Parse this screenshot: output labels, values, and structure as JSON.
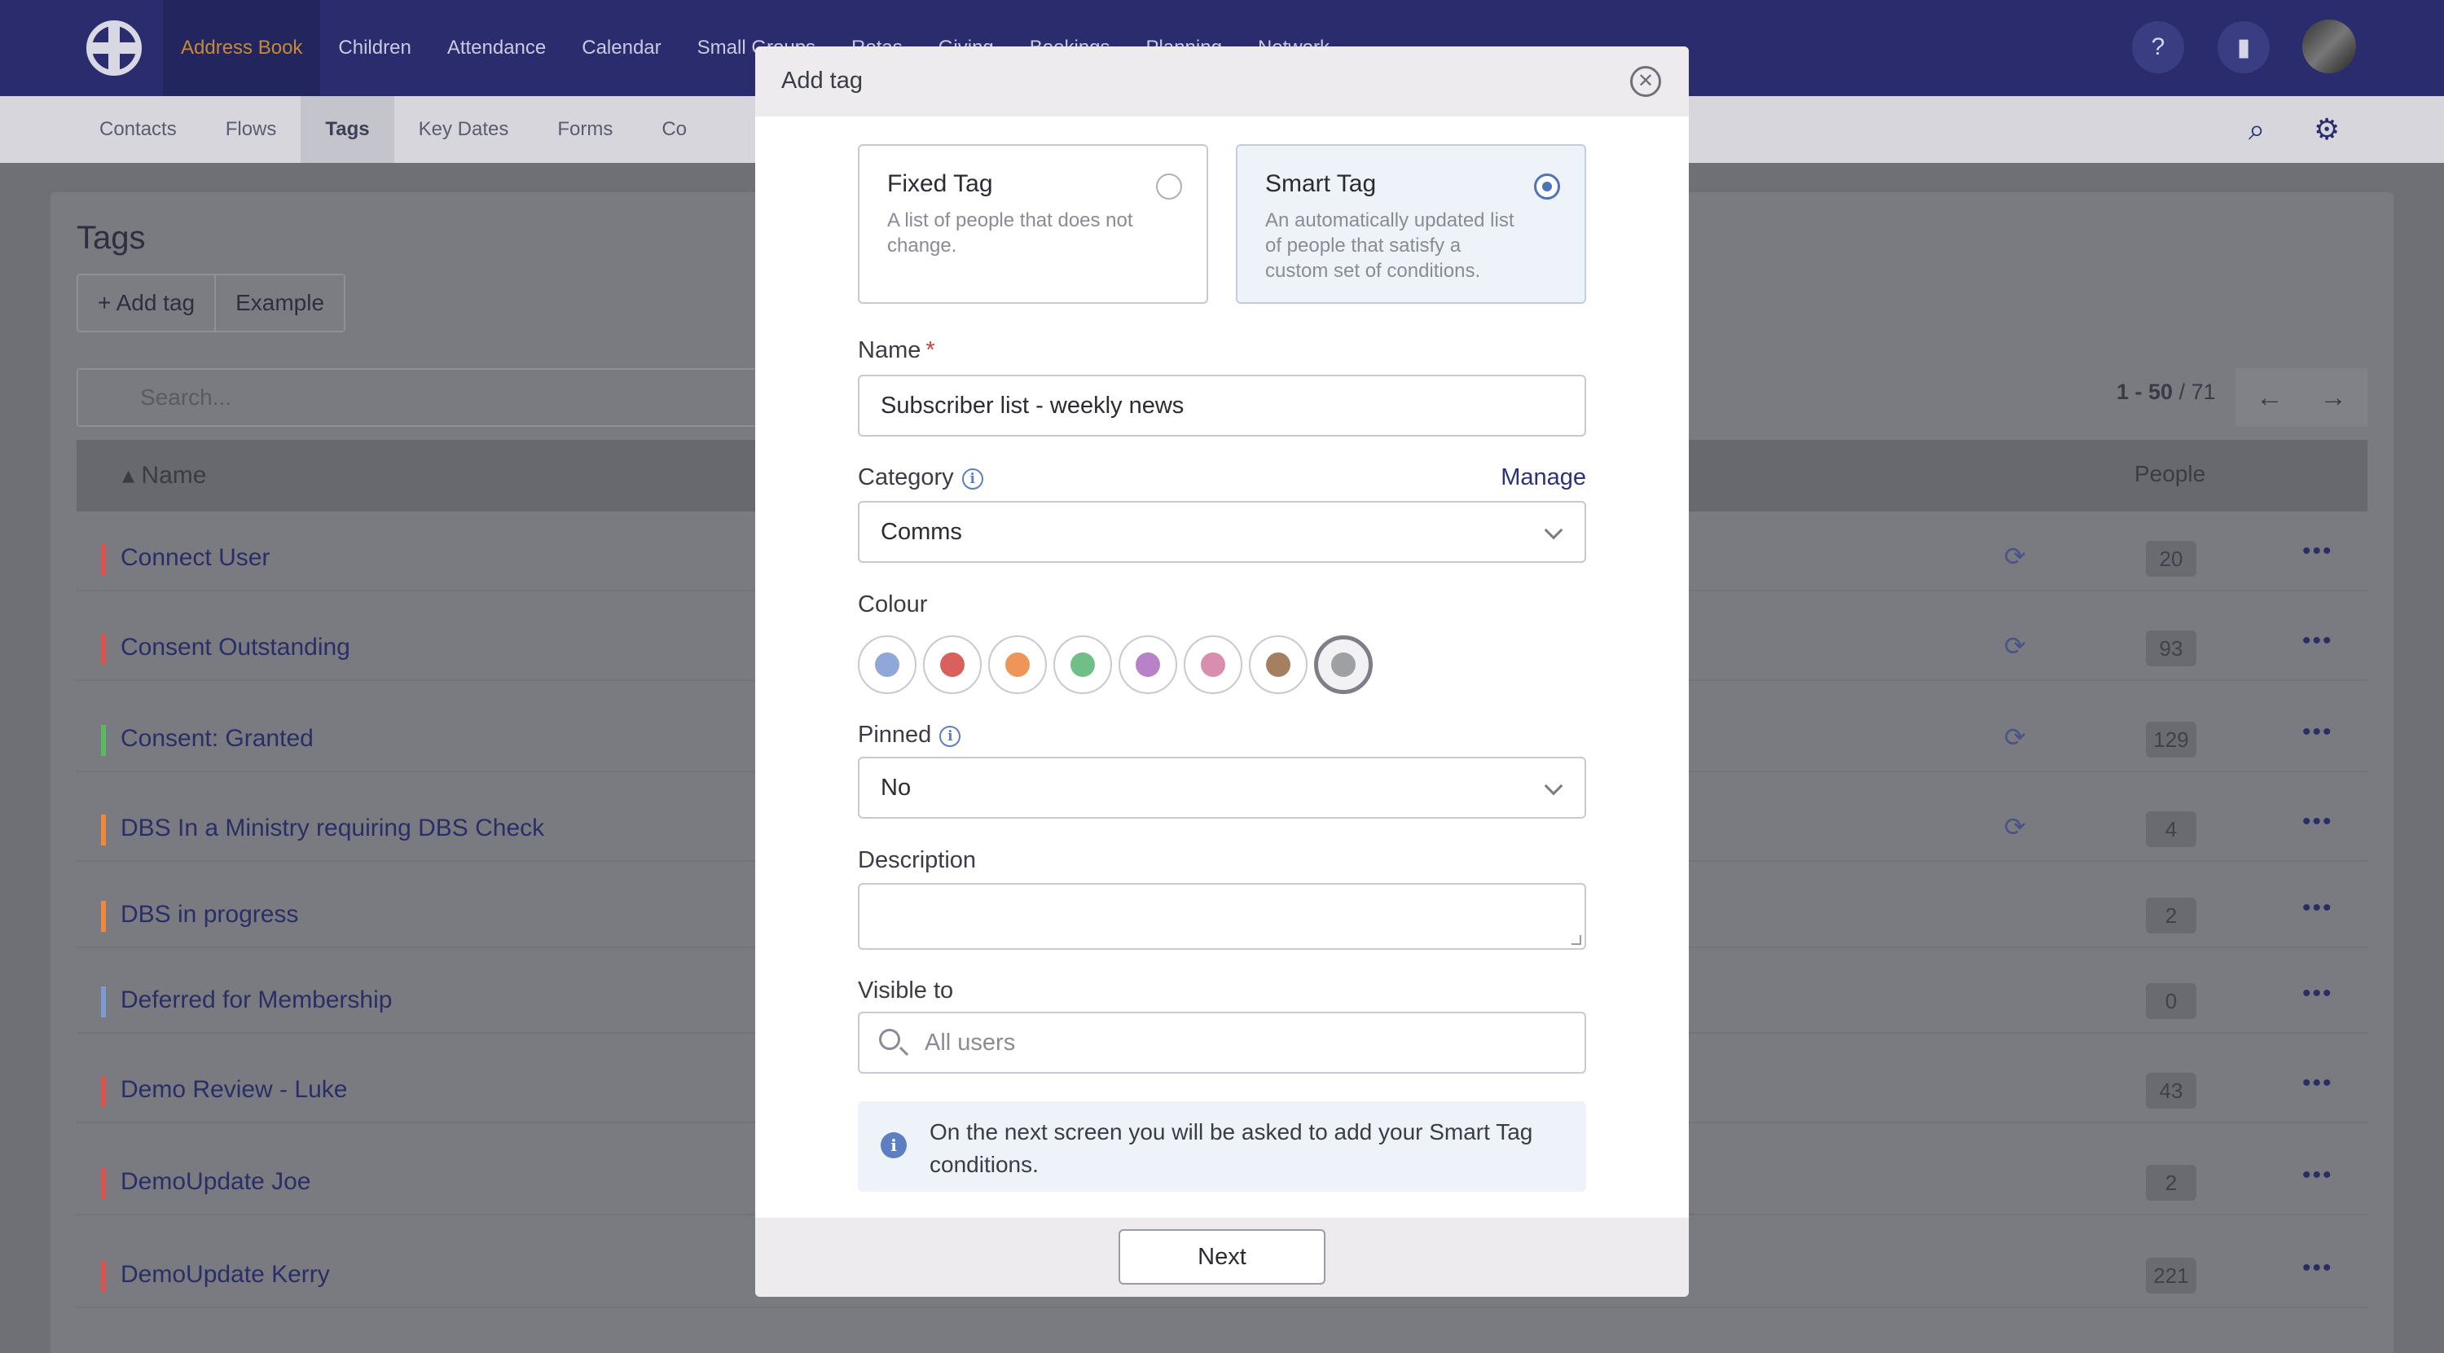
{
  "topnav": {
    "items": [
      "Address Book",
      "Children",
      "Attendance",
      "Calendar",
      "Small Groups",
      "Rotas",
      "Giving",
      "Bookings",
      "Planning",
      "Network"
    ],
    "help_icon": "help-circle-icon",
    "org_icon": "building-icon"
  },
  "subnav": {
    "items": [
      "Contacts",
      "Flows",
      "Tags",
      "Key Dates",
      "Forms",
      "Co"
    ],
    "search_icon": "search-icon",
    "settings_icon": "gear-icon"
  },
  "page": {
    "title": "Tags",
    "add_tag_label": "+ Add tag",
    "example_label": "Example",
    "search_placeholder": "Search...",
    "pager_range": "1 - 50",
    "pager_total": "/ 71",
    "col_name": "Name",
    "col_people": "People",
    "rows": [
      {
        "name": "Connect User",
        "count": "20",
        "color": "#d9534f"
      },
      {
        "name": "Consent Outstanding",
        "count": "93",
        "color": "#d9534f"
      },
      {
        "name": "Consent: Granted",
        "count": "129",
        "color": "#5cb85c"
      },
      {
        "name": "DBS In a Ministry requiring DBS Check",
        "count": "4",
        "color": "#f0883e"
      },
      {
        "name": "DBS in progress",
        "count": "2",
        "color": "#f0883e"
      },
      {
        "name": "Deferred for Membership",
        "count": "0",
        "color": "#7b9ad6"
      },
      {
        "name": "Demo Review - Luke",
        "count": "43",
        "color": "#d9534f"
      },
      {
        "name": "DemoUpdate Joe",
        "count": "2",
        "color": "#d9534f"
      },
      {
        "name": "DemoUpdate Kerry",
        "count": "221",
        "color": "#d9534f"
      }
    ]
  },
  "modal": {
    "title": "Add tag",
    "fixed_tag": {
      "title": "Fixed Tag",
      "desc": "A list of people that does not change."
    },
    "smart_tag": {
      "title": "Smart Tag",
      "desc": "An automatically updated list of people that satisfy a custom set of conditions."
    },
    "name_label": "Name",
    "name_required": "*",
    "name_value": "Subscriber list - weekly news",
    "category_label": "Category",
    "manage_label": "Manage",
    "category_value": "Comms",
    "colour_label": "Colour",
    "colours": [
      "#8fa8d8",
      "#d9605c",
      "#ee9657",
      "#6fbf86",
      "#b883c6",
      "#d98eae",
      "#a58060",
      "#9fa0a4"
    ],
    "pinned_label": "Pinned",
    "pinned_value": "No",
    "description_label": "Description",
    "visible_label": "Visible to",
    "visible_placeholder": "All users",
    "info_text": "On the next screen you will be asked to add your Smart Tag conditions.",
    "next_label": "Next"
  }
}
